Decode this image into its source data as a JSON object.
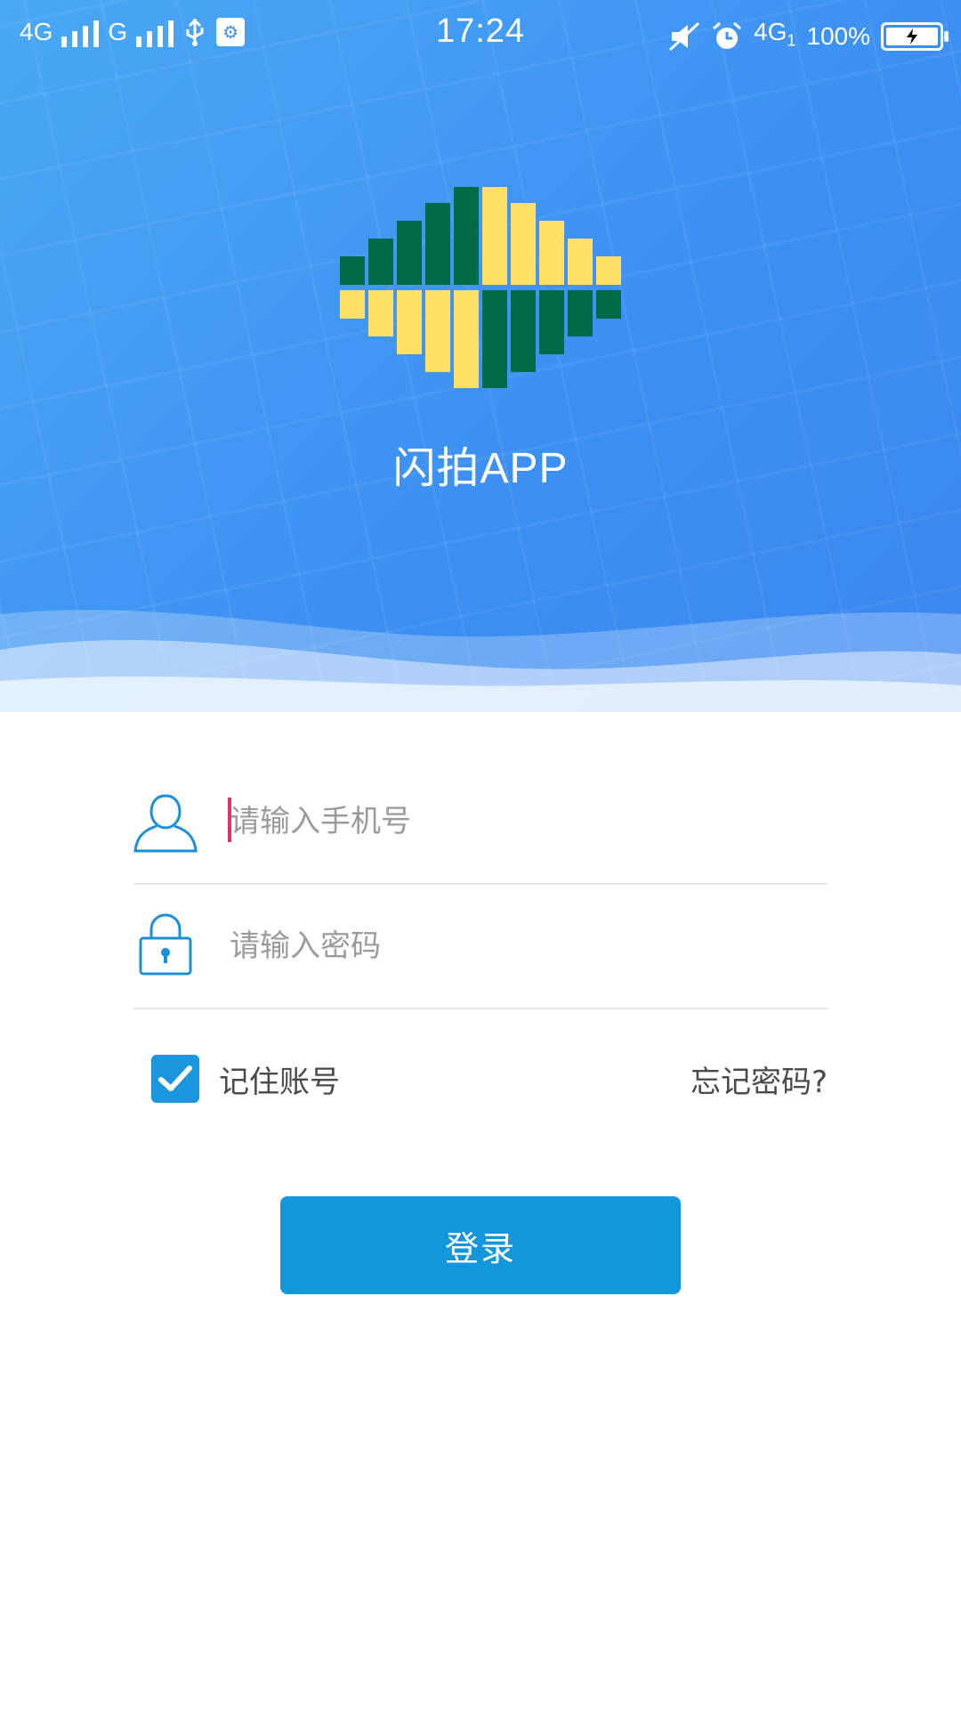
{
  "status_bar": {
    "network_1": "4G",
    "network_2": "G",
    "time": "17:24",
    "network_3": "4G",
    "network_3_sub": "1",
    "battery": "100%"
  },
  "app": {
    "title": "闪拍APP"
  },
  "form": {
    "phone_placeholder": "请输入手机号",
    "password_placeholder": "请输入密码",
    "remember_label": "记住账号",
    "remember_checked": true,
    "forgot_label": "忘记密码?",
    "login_label": "登录"
  },
  "colors": {
    "hero_blue": "#3d91f2",
    "accent_blue": "#1397dc",
    "logo_green": "#006b47",
    "logo_yellow": "#ffe066",
    "cursor_pink": "#e2316f"
  }
}
